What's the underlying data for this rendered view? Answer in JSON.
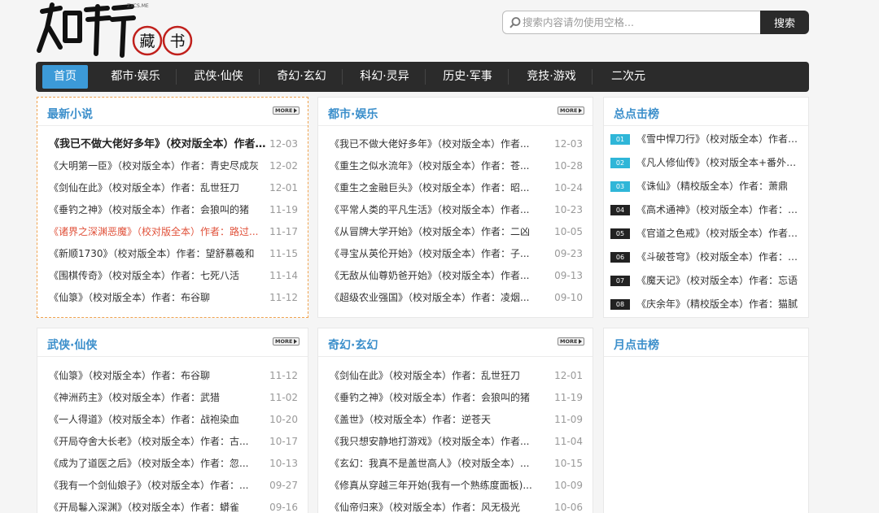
{
  "site": {
    "logo_text": "知轩藏书",
    "logo_small": "ZXCS.ME"
  },
  "search": {
    "placeholder": "搜索内容请勿使用空格...",
    "button": "搜索"
  },
  "nav": [
    "首页",
    "都市·娱乐",
    "武侠·仙侠",
    "奇幻·玄幻",
    "科幻·灵异",
    "历史·军事",
    "竞技·游戏",
    "二次元"
  ],
  "more_label": "MORE",
  "panels": {
    "latest": {
      "title": "最新小说",
      "items": [
        {
          "t": "《我已不做大佬好多年》（校对版全本）作者：...",
          "d": "12-03"
        },
        {
          "t": "《大明第一臣》（校对版全本）作者：青史尽成灰",
          "d": "12-02"
        },
        {
          "t": "《剑仙在此》（校对版全本）作者：乱世狂刀",
          "d": "12-01"
        },
        {
          "t": "《垂钓之神》（校对版全本）作者：会狼叫的猪",
          "d": "11-19"
        },
        {
          "t": "《诸界之深渊恶魔》（校对版全本）作者：路过...",
          "d": "11-17"
        },
        {
          "t": "《新顺1730》（校对版全本）作者：望舒慕羲和",
          "d": "11-15"
        },
        {
          "t": "《围棋传奇》（校对版全本）作者：七死八活",
          "d": "11-14"
        },
        {
          "t": "《仙箓》（校对版全本）作者：布谷聊",
          "d": "11-12"
        }
      ]
    },
    "urban": {
      "title": "都市·娱乐",
      "items": [
        {
          "t": "《我已不做大佬好多年》（校对版全本）作者...",
          "d": "12-03"
        },
        {
          "t": "《重生之似水流年》（校对版全本）作者：苍...",
          "d": "10-28"
        },
        {
          "t": "《重生之金融巨头》（校对版全本）作者：昭...",
          "d": "10-24"
        },
        {
          "t": "《平常人类的平凡生活》（校对版全本）作者...",
          "d": "10-23"
        },
        {
          "t": "《从冒牌大学开始》（校对版全本）作者：二凶",
          "d": "10-05"
        },
        {
          "t": "《寻宝从英伦开始》（校对版全本）作者：子...",
          "d": "09-23"
        },
        {
          "t": "《无敌从仙尊奶爸开始》（校对版全本）作者...",
          "d": "09-13"
        },
        {
          "t": "《超级农业强国》（校对版全本）作者：凌烟...",
          "d": "09-10"
        }
      ]
    },
    "total": {
      "title": "总点击榜",
      "items": [
        {
          "n": "01",
          "t": "《雪中悍刀行》（校对版全本）作者：烽火..."
        },
        {
          "n": "02",
          "t": "《凡人修仙传》（校对版全本+番外）作..."
        },
        {
          "n": "03",
          "t": "《诛仙》（精校版全本）作者：萧鼎"
        },
        {
          "n": "04",
          "t": "《高术通神》（校对版全本）作者：手..."
        },
        {
          "n": "05",
          "t": "《官道之色戒》（校对版全本）作者：..."
        },
        {
          "n": "06",
          "t": "《斗破苍穹》（校对版全本）作者：天..."
        },
        {
          "n": "07",
          "t": "《魔天记》（校对版全本）作者：忘语"
        },
        {
          "n": "08",
          "t": "《庆余年》（精校版全本）作者：猫腻"
        }
      ]
    },
    "wuxia": {
      "title": "武侠·仙侠",
      "items": [
        {
          "t": "《仙箓》（校对版全本）作者：布谷聊",
          "d": "11-12"
        },
        {
          "t": "《神洲药主》（校对版全本）作者：武猎",
          "d": "11-02"
        },
        {
          "t": "《一人得道》（校对版全本）作者：战袍染血",
          "d": "10-20"
        },
        {
          "t": "《开局夺舍大长老》（校对版全本）作者：古...",
          "d": "10-17"
        },
        {
          "t": "《成为了道医之后》（校对版全本）作者：忽...",
          "d": "10-13"
        },
        {
          "t": "《我有一个剑仙娘子》（校对版全本）作者：...",
          "d": "09-27"
        },
        {
          "t": "《开局鬈入深渊》（校对版全本）作者：蟒雀",
          "d": "09-16"
        }
      ]
    },
    "fantasy": {
      "title": "奇幻·玄幻",
      "items": [
        {
          "t": "《剑仙在此》（校对版全本）作者：乱世狂刀",
          "d": "12-01"
        },
        {
          "t": "《垂钓之神》（校对版全本）作者：会狼叫的猪",
          "d": "11-19"
        },
        {
          "t": "《盖世》（校对版全本）作者：逆苍天",
          "d": "11-09"
        },
        {
          "t": "《我只想安静地打游戏》（校对版全本）作者...",
          "d": "11-04"
        },
        {
          "t": "《玄幻：我真不是盖世高人》（校对版全本）...",
          "d": "10-15"
        },
        {
          "t": "《修真从穿越三年开始(我有一个熟练度面板)...",
          "d": "10-09"
        },
        {
          "t": "《仙帝归来》（校对版全本）作者：风无极光",
          "d": "10-06"
        }
      ]
    },
    "monthly": {
      "title": "月点击榜"
    }
  }
}
